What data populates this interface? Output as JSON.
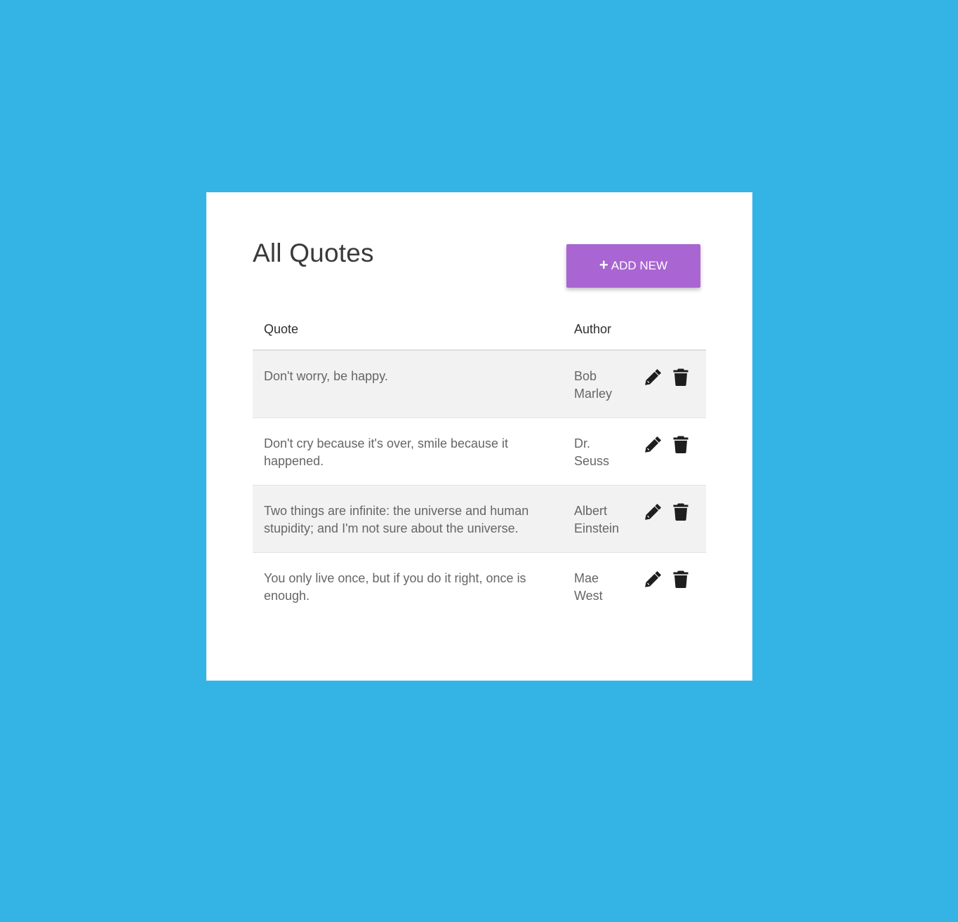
{
  "header": {
    "title": "All Quotes",
    "add_button_label": "ADD NEW",
    "add_button_icon": "+"
  },
  "table": {
    "columns": [
      "Quote",
      "Author",
      ""
    ],
    "rows": [
      {
        "quote": "Don't worry, be happy.",
        "author": "Bob Marley"
      },
      {
        "quote": "Don't cry because it's over, smile because it happened.",
        "author": "Dr. Seuss"
      },
      {
        "quote": "Two things are infinite: the universe and human stupidity; and I'm not sure about the universe.",
        "author": "Albert Einstein"
      },
      {
        "quote": "You only live once, but if you do it right, once is enough.",
        "author": "Mae West"
      }
    ],
    "row_actions": [
      "pencil-icon",
      "trash-icon"
    ]
  },
  "colors": {
    "background": "#34b4e5",
    "card": "#ffffff",
    "accent": "#a965d1",
    "stripe": "#f2f2f2"
  }
}
